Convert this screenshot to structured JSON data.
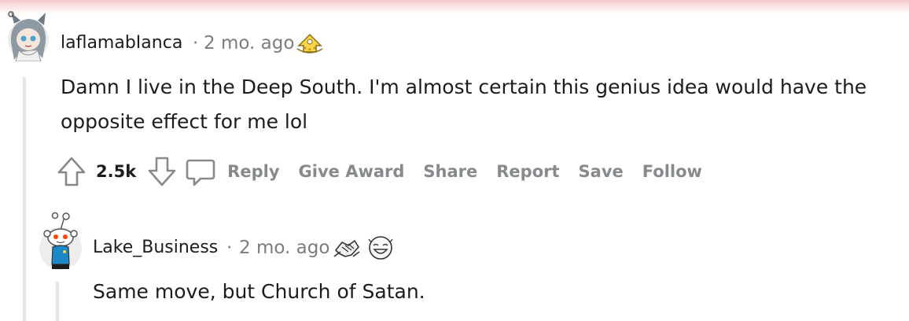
{
  "colors": {
    "text": "#1c1c1c",
    "meta": "#7c7c7c",
    "action": "#878a8c",
    "thread_line": "#e6e6e6",
    "top_glow": "#f6c8cc"
  },
  "comments": [
    {
      "username": "laflamabIanca",
      "separator": "·",
      "age": "2 mo. ago",
      "body": "Damn I live in the Deep South. I'm almost certain this genius idea would have the opposite effect for me lol",
      "awards": [
        "gold-award-icon"
      ],
      "score": "2.5k",
      "actions": {
        "reply": "Reply",
        "give_award": "Give Award",
        "share": "Share",
        "report": "Report",
        "save": "Save",
        "follow": "Follow"
      }
    },
    {
      "username": "Lake_Business",
      "separator": "·",
      "age": "2 mo. ago",
      "body": "Same move, but Church of Satan.",
      "awards": [
        "handshake-award-icon",
        "laughing-award-icon"
      ]
    }
  ]
}
